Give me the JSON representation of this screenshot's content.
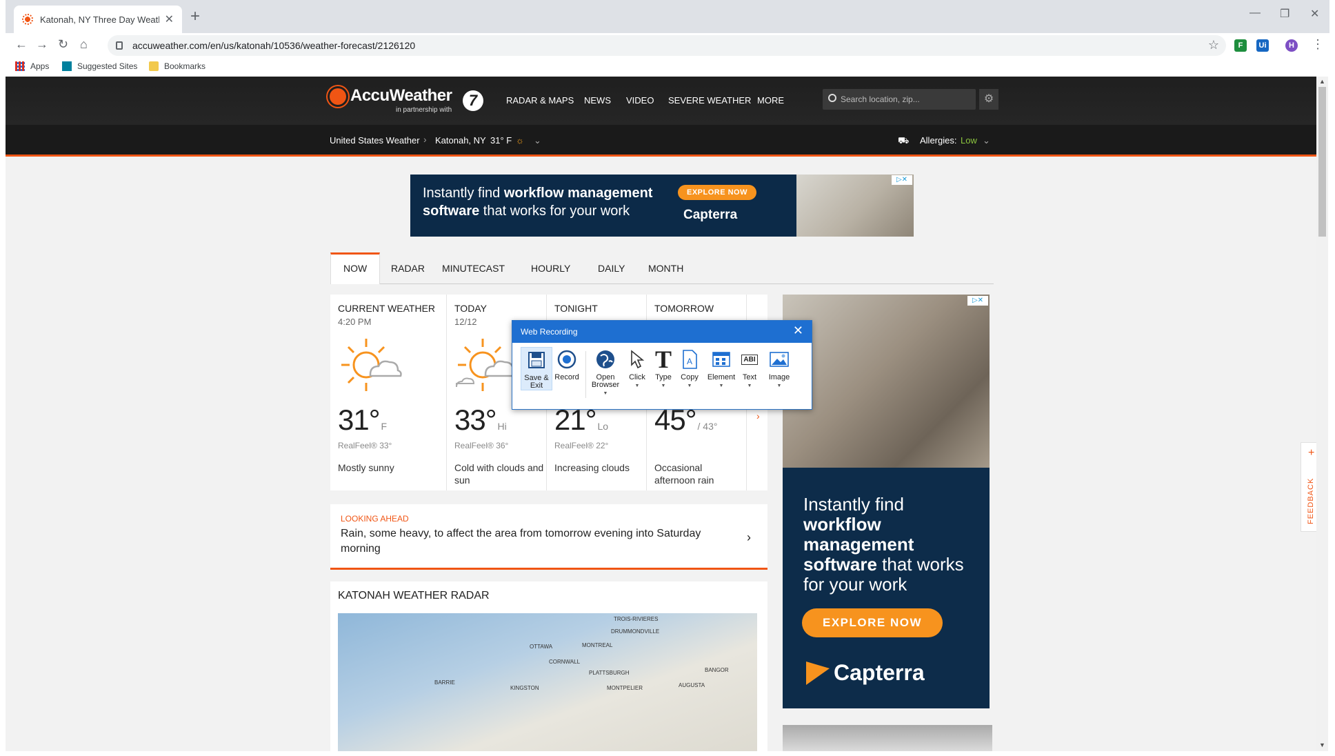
{
  "browser": {
    "tab_title": "Katonah, NY Three Day Weather",
    "url": "accuweather.com/en/us/katonah/10536/weather-forecast/2126120",
    "bookmarks": [
      "Apps",
      "Suggested Sites",
      "Bookmarks"
    ],
    "profile_initial": "H"
  },
  "header": {
    "brand": "AccuWeather",
    "partner": "in partnership with",
    "nav": [
      "RADAR & MAPS",
      "NEWS",
      "VIDEO",
      "SEVERE WEATHER",
      "MORE"
    ],
    "search_placeholder": "Search location, zip..."
  },
  "subheader": {
    "breadcrumb_root": "United States Weather",
    "location": "Katonah, NY",
    "current_temp": "31° F",
    "allergies_label": "Allergies:",
    "allergies_value": "Low"
  },
  "top_ad": {
    "line1_pre": "Instantly find ",
    "line1_bold": "workflow management",
    "line2_bold": "software",
    "line2_post": " that works for your work",
    "cta": "EXPLORE NOW",
    "logo": "Capterra"
  },
  "forecast_tabs": [
    "NOW",
    "RADAR",
    "MINUTECAST",
    "HOURLY",
    "DAILY",
    "MONTH"
  ],
  "cards": [
    {
      "label": "CURRENT WEATHER",
      "time": "4:20 PM",
      "temp": "31°",
      "suffix": "F",
      "realfeel": "RealFeel® 33°",
      "phrase": "Mostly sunny"
    },
    {
      "label": "TODAY",
      "time": "12/12",
      "temp": "33°",
      "suffix": "Hi",
      "realfeel": "RealFeel® 36°",
      "phrase": "Cold with clouds and sun"
    },
    {
      "label": "TONIGHT",
      "time": "",
      "temp": "21°",
      "suffix": "Lo",
      "realfeel": "RealFeel® 22°",
      "phrase": "Increasing clouds"
    },
    {
      "label": "TOMORROW",
      "time": "",
      "temp": "45°",
      "suffix": "/ 43°",
      "realfeel": "",
      "phrase": "Occasional afternoon rain"
    }
  ],
  "looking_ahead": {
    "kicker": "LOOKING AHEAD",
    "text": "Rain, some heavy, to affect the area from tomorrow evening into Saturday morning"
  },
  "radar": {
    "heading": "KATONAH WEATHER RADAR",
    "cities": [
      "TROIS-RIVIERES",
      "DRUMMONDVILLE",
      "OTTAWA",
      "MONTREAL",
      "CORNWALL",
      "PLATTSBURGH",
      "BANGOR",
      "BARRIE",
      "KINGSTON",
      "MONTPELIER",
      "AUGUSTA"
    ]
  },
  "side_ad": {
    "line1": "Instantly find",
    "bold1": "workflow",
    "bold2": "management",
    "bold3": "software",
    "post": " that works for your work",
    "cta": "EXPLORE NOW",
    "logo": "Capterra"
  },
  "feedback": "FEEDBACK",
  "recorder": {
    "title": "Web Recording",
    "tools": [
      "Save & Exit",
      "Record",
      "Open Browser",
      "Click",
      "Type",
      "Copy",
      "Element",
      "Text",
      "Image"
    ]
  },
  "colors": {
    "accent": "#f05514",
    "header_bg": "#1f1f1f",
    "ad_bg": "#0d2c4a",
    "ad_cta": "#f7931e",
    "recorder_title": "#1e6fd1"
  }
}
